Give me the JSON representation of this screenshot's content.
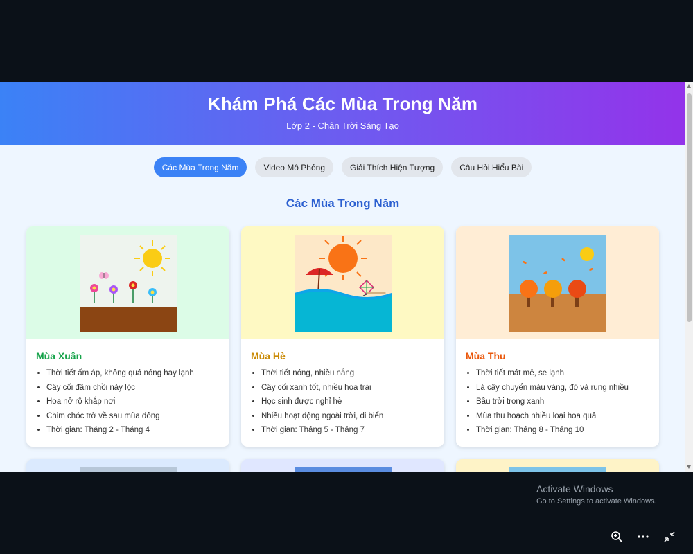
{
  "header": {
    "title": "Khám Phá Các Mùa Trong Năm",
    "subtitle": "Lớp 2 - Chân Trời Sáng Tạo"
  },
  "tabs": [
    {
      "label": "Các Mùa Trong Năm",
      "active": true
    },
    {
      "label": "Video Mô Phỏng",
      "active": false
    },
    {
      "label": "Giải Thích Hiện Tượng",
      "active": false
    },
    {
      "label": "Câu Hỏi Hiểu Bài",
      "active": false
    }
  ],
  "section_title": "Các Mùa Trong Năm",
  "seasons": [
    {
      "title": "Mùa Xuân",
      "title_color": "#16a34a",
      "bg_color": "#dcfce7",
      "items": [
        "Thời tiết ấm áp, không quá nóng hay lạnh",
        "Cây cối đâm chồi nảy lộc",
        "Hoa nở rộ khắp nơi",
        "Chim chóc trở về sau mùa đông",
        "Thời gian: Tháng 2 - Tháng 4"
      ]
    },
    {
      "title": "Mùa Hè",
      "title_color": "#ca8a04",
      "bg_color": "#fef9c3",
      "items": [
        "Thời tiết nóng, nhiều nắng",
        "Cây cối xanh tốt, nhiều hoa trái",
        "Học sinh được nghỉ hè",
        "Nhiều hoạt động ngoài trời, đi biển",
        "Thời gian: Tháng 5 - Tháng 7"
      ]
    },
    {
      "title": "Mùa Thu",
      "title_color": "#ea580c",
      "bg_color": "#ffedd5",
      "items": [
        "Thời tiết mát mẻ, se lạnh",
        "Lá cây chuyển màu vàng, đỏ và rụng nhiều",
        "Bầu trời trong xanh",
        "Mùa thu hoạch nhiều loại hoa quả",
        "Thời gian: Tháng 8 - Tháng 10"
      ]
    }
  ],
  "partial_cards_bg": [
    "#dbeafe",
    "#e0e7ff",
    "#fef3c7"
  ],
  "windows_notice": {
    "title": "Activate Windows",
    "subtitle": "Go to Settings to activate Windows."
  },
  "viewer_controls": [
    "zoom-in-icon",
    "more-options-icon",
    "exit-fullscreen-icon"
  ]
}
